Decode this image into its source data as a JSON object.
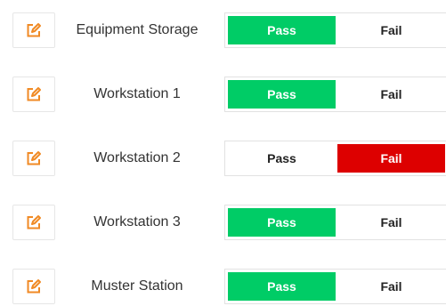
{
  "colors": {
    "pass_selected_bg": "#00cc66",
    "fail_selected_bg": "#dd0000",
    "edit_icon": "#f08a24"
  },
  "icons": {
    "edit": "edit-icon"
  },
  "options": {
    "pass_label": "Pass",
    "fail_label": "Fail"
  },
  "rows": [
    {
      "label": "Equipment Storage",
      "selected": "Pass"
    },
    {
      "label": "Workstation 1",
      "selected": "Pass"
    },
    {
      "label": "Workstation 2",
      "selected": "Fail"
    },
    {
      "label": "Workstation 3",
      "selected": "Pass"
    },
    {
      "label": "Muster Station",
      "selected": "Pass"
    }
  ]
}
